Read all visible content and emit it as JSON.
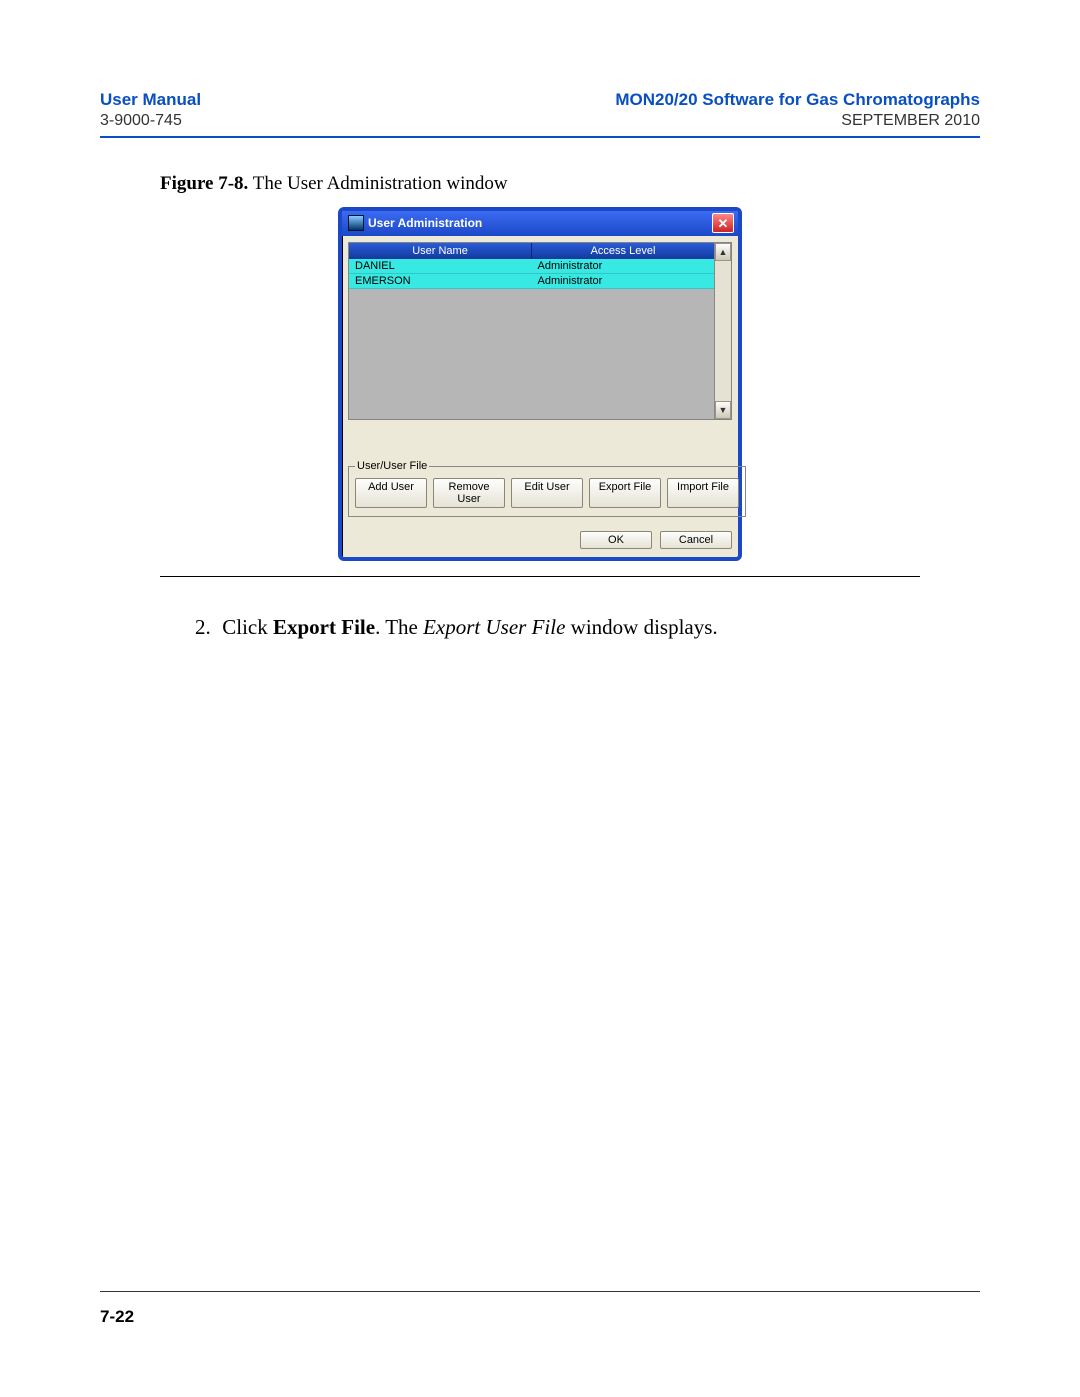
{
  "header": {
    "left_title": "User Manual",
    "right_title": "MON20/20 Software for Gas Chromatographs",
    "doc_number": "3-9000-745",
    "date": "SEPTEMBER 2010"
  },
  "figure": {
    "label_strong": "Figure 7-8.",
    "label_rest": "  The User Administration window"
  },
  "dialog": {
    "title": "User Administration",
    "close_glyph": "✕",
    "columns": {
      "username": "User Name",
      "accesslevel": "Access Level"
    },
    "rows": [
      {
        "user": "DANIEL",
        "access": "Administrator"
      },
      {
        "user": "EMERSON",
        "access": "Administrator"
      }
    ],
    "scroll_up": "▲",
    "scroll_down": "▼",
    "fieldset_legend": "User/User File",
    "buttons": {
      "add": "Add User",
      "remove": "Remove User",
      "edit": "Edit User",
      "export": "Export File",
      "import": "Import File"
    },
    "ok": "OK",
    "cancel": "Cancel"
  },
  "step": {
    "number": "2.",
    "pre": "Click ",
    "bold": "Export File",
    "mid": ".  The ",
    "italic": "Export User File",
    "post": " window displays."
  },
  "footer": {
    "page": "7-22"
  }
}
